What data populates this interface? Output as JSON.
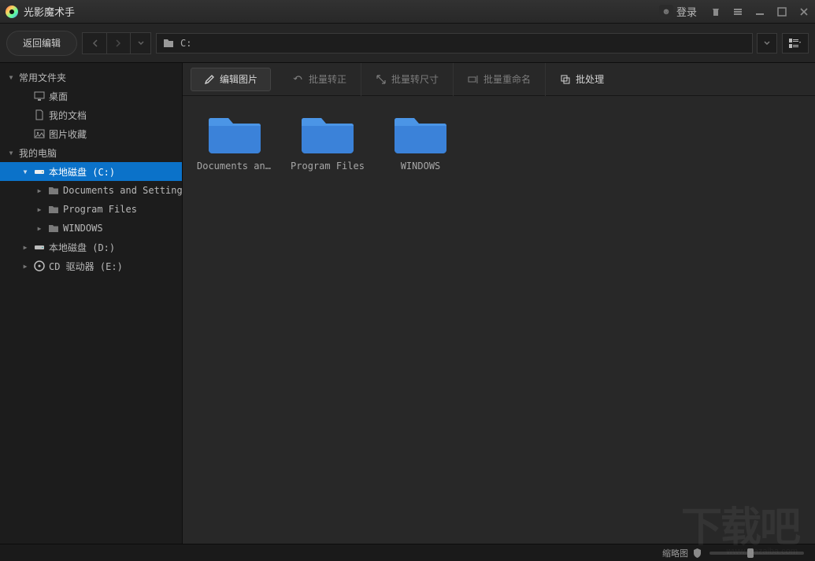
{
  "app_title": "光影魔术手",
  "login_label": "登录",
  "back_label": "返回编辑",
  "current_path": "C:",
  "sidebar": {
    "favorites_label": "常用文件夹",
    "desktop": "桌面",
    "documents": "我的文档",
    "pictures": "图片收藏",
    "computer_label": "我的电脑",
    "drive_c": "本地磁盘 (C:)",
    "c_sub1": "Documents and Settings",
    "c_sub2": "Program Files",
    "c_sub3": "WINDOWS",
    "drive_d": "本地磁盘 (D:)",
    "drive_e": "CD 驱动器 (E:)"
  },
  "toolbar": {
    "edit": "编辑图片",
    "rotate": "批量转正",
    "resize": "批量转尺寸",
    "rename": "批量重命名",
    "batch": "批处理"
  },
  "folders": [
    {
      "label": "Documents an..."
    },
    {
      "label": "Program Files"
    },
    {
      "label": "WINDOWS"
    }
  ],
  "status": {
    "thumb_label": "缩略图"
  },
  "watermark": "下载吧",
  "watermark_sub": "www.xiazaiba.com"
}
